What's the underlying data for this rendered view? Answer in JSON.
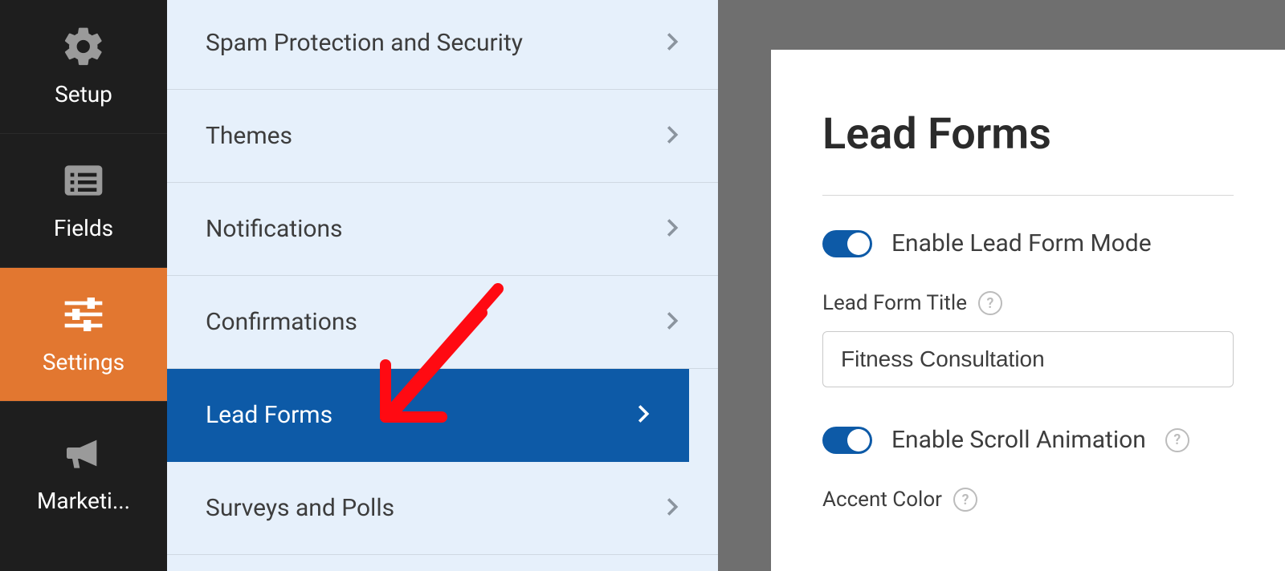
{
  "sidebar": {
    "items": [
      {
        "label": "Setup",
        "icon": "gear-icon",
        "active": false
      },
      {
        "label": "Fields",
        "icon": "list-icon",
        "active": false
      },
      {
        "label": "Settings",
        "icon": "sliders-icon",
        "active": true
      },
      {
        "label": "Marketi...",
        "icon": "megaphone-icon",
        "active": false
      }
    ]
  },
  "submenu": {
    "items": [
      {
        "label": "Spam Protection and Security",
        "active": false
      },
      {
        "label": "Themes",
        "active": false
      },
      {
        "label": "Notifications",
        "active": false
      },
      {
        "label": "Confirmations",
        "active": false
      },
      {
        "label": "Lead Forms",
        "active": true
      },
      {
        "label": "Surveys and Polls",
        "active": false
      }
    ]
  },
  "panel": {
    "title": "Lead Forms",
    "enable_mode_label": "Enable Lead Form Mode",
    "enable_mode_on": true,
    "title_field_label": "Lead Form Title",
    "title_field_value": "Fitness Consultation",
    "enable_scroll_label": "Enable Scroll Animation",
    "enable_scroll_on": true,
    "accent_color_label": "Accent Color"
  },
  "annotation": {
    "type": "hand-drawn-arrow",
    "color": "#ff0a12",
    "points_to": "submenu.items.4"
  }
}
